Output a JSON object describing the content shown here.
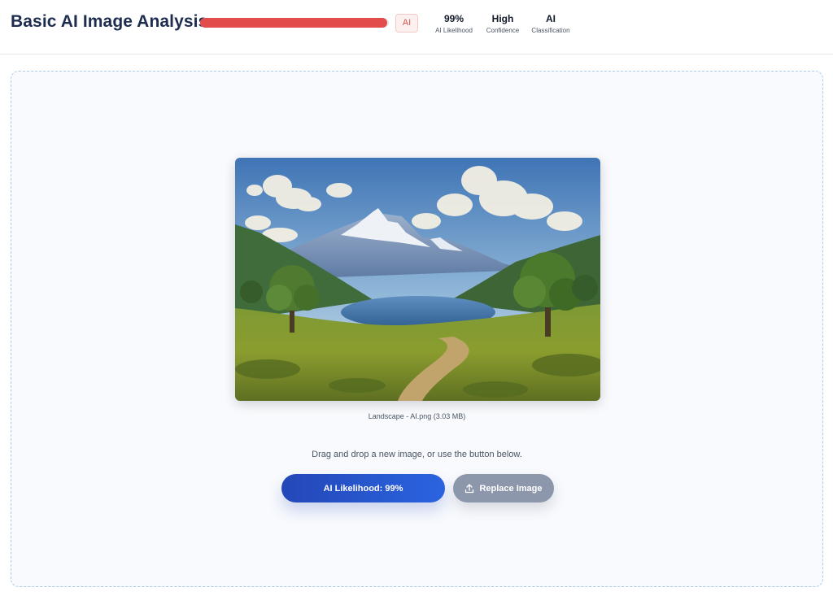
{
  "header": {
    "title": "Basic AI Image Analysis",
    "meter": {
      "level": 0.99,
      "color": "#e24c4b"
    },
    "badge": "AI",
    "stats": [
      {
        "value": "99%",
        "label": "AI Likelihood"
      },
      {
        "value": "High",
        "label": "Confidence"
      },
      {
        "value": "AI",
        "label": "Classification"
      }
    ]
  },
  "dropzone": {
    "image_alt": "Landscape painting of snowy mountains, lake, trees and a dirt path",
    "file_caption": "Landscape - AI.png (3.03 MB)",
    "hint": "Drag and drop a new image, or use the button below.",
    "likelihood_button": "AI Likelihood: 99%",
    "replace_button": "Replace Image",
    "replace_icon": "upload-icon"
  },
  "colors": {
    "accent_blue": "#2a5bd7",
    "danger_red": "#e24c4b",
    "dropzone_border": "#a9cde9"
  }
}
